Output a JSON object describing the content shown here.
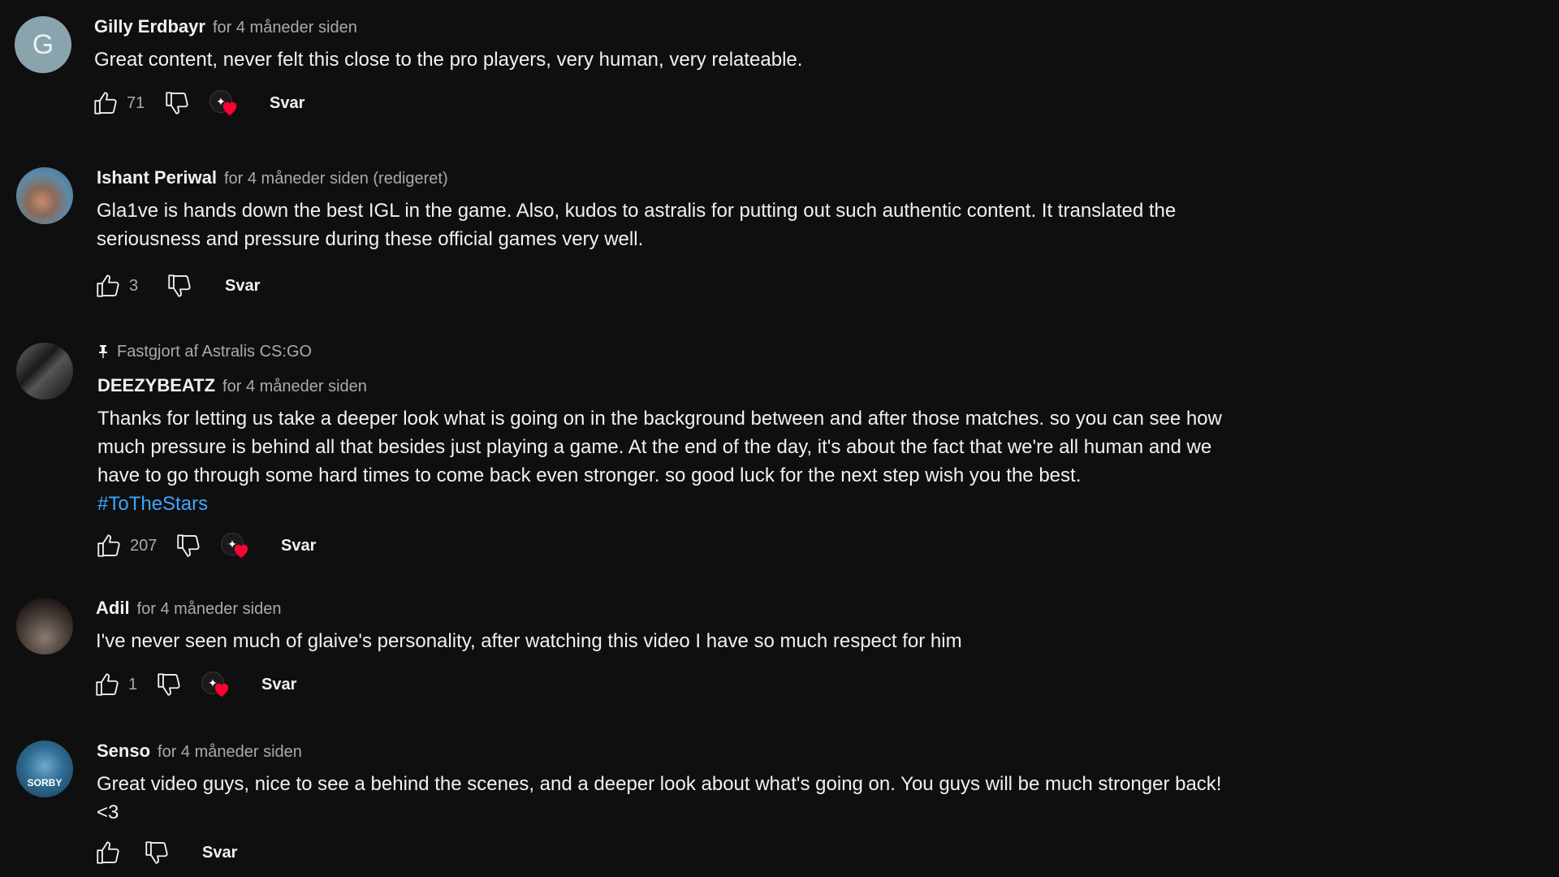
{
  "comments": [
    {
      "author": "Gilly Erdbayr",
      "time": "for 4 måneder siden",
      "avatar_letter": "G",
      "text": "Great content, never felt this close to the pro players, very human, very relateable.",
      "likes": "71",
      "creator_heart": true,
      "reply_label": "Svar"
    },
    {
      "author": "Ishant Periwal",
      "time": "for 4 måneder siden (redigeret)",
      "text": "Gla1ve is hands down the best IGL in the game. Also, kudos to astralis for putting out such authentic content. It translated the seriousness and pressure during these official games very well.",
      "likes": "3",
      "creator_heart": false,
      "reply_label": "Svar"
    },
    {
      "pinned_label": "Fastgjort af Astralis CS:GO",
      "author": "DEEZYBEATZ",
      "time": "for 4 måneder siden",
      "text": "Thanks for letting us take a deeper look what is going on in the background between and after those matches. so you can see how much pressure is behind all that besides just playing a game. At the end of the day, it's about the fact that we're all human and we have to go through some hard times to come back even stronger. so good luck for the next step wish you the best.",
      "hashtag": "#ToTheStars",
      "likes": "207",
      "creator_heart": true,
      "reply_label": "Svar"
    },
    {
      "author": "Adil",
      "time": "for 4 måneder siden",
      "text": "I've never seen much of glaive's personality, after watching this video I have so much respect for him",
      "likes": "1",
      "creator_heart": true,
      "reply_label": "Svar"
    },
    {
      "author": "Senso",
      "time": "for 4 måneder siden",
      "text": "Great video guys, nice to see a behind the scenes, and a deeper look about what's going on. You guys will be much stronger back! <3",
      "likes": "",
      "creator_heart": false,
      "reply_label": "Svar"
    }
  ],
  "colors": {
    "background": "#0f0f0f",
    "text": "#f1f1f1",
    "secondary_text": "#aaaaaa",
    "link": "#3ea6ff",
    "heart": "#ff0033"
  },
  "icons": [
    "thumbs-up-icon",
    "thumbs-down-icon",
    "creator-heart-icon",
    "pin-icon"
  ]
}
